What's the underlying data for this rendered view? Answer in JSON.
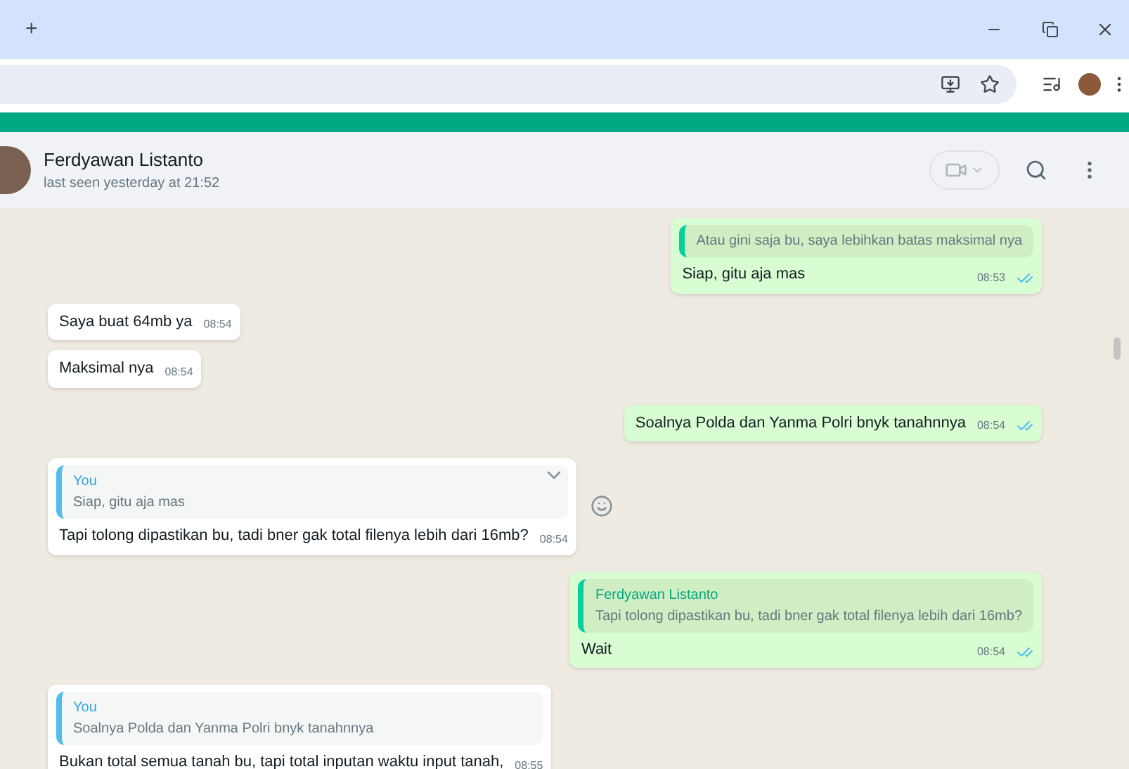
{
  "tab_strip": {
    "new_tab": "+"
  },
  "chat_header": {
    "name": "Ferdyawan Listanto",
    "status": "last seen yesterday at 21:52"
  },
  "messages": [
    {
      "kind": "out",
      "quote": {
        "text": "Atau gini saja bu, saya lebihkan batas maksimal nya"
      },
      "text": "Siap, gitu aja mas",
      "time": "08:53",
      "read": true
    },
    {
      "kind": "in",
      "text": "Saya buat 64mb ya",
      "time": "08:54"
    },
    {
      "kind": "in",
      "text": "Maksimal nya",
      "time": "08:54"
    },
    {
      "kind": "out",
      "text": "Soalnya Polda dan Yanma Polri bnyk tanahnnya",
      "time": "08:54",
      "read": true
    },
    {
      "kind": "in",
      "hovered": true,
      "quote": {
        "sender": "You",
        "text": "Siap, gitu aja mas"
      },
      "text": "Tapi tolong dipastikan bu, tadi bner gak total filenya lebih dari 16mb?",
      "time": "08:54"
    },
    {
      "kind": "out",
      "quote": {
        "sender": "Ferdyawan Listanto",
        "text": "Tapi tolong dipastikan bu, tadi bner gak total filenya lebih dari 16mb?"
      },
      "text": "Wait",
      "time": "08:54",
      "read": true
    },
    {
      "kind": "in",
      "quote": {
        "sender": "You",
        "text": "Soalnya Polda dan Yanma Polri bnyk tanahnnya"
      },
      "text": "Bukan total semua tanah bu, tapi total inputan waktu input tanah,",
      "time": "08:55"
    }
  ]
}
